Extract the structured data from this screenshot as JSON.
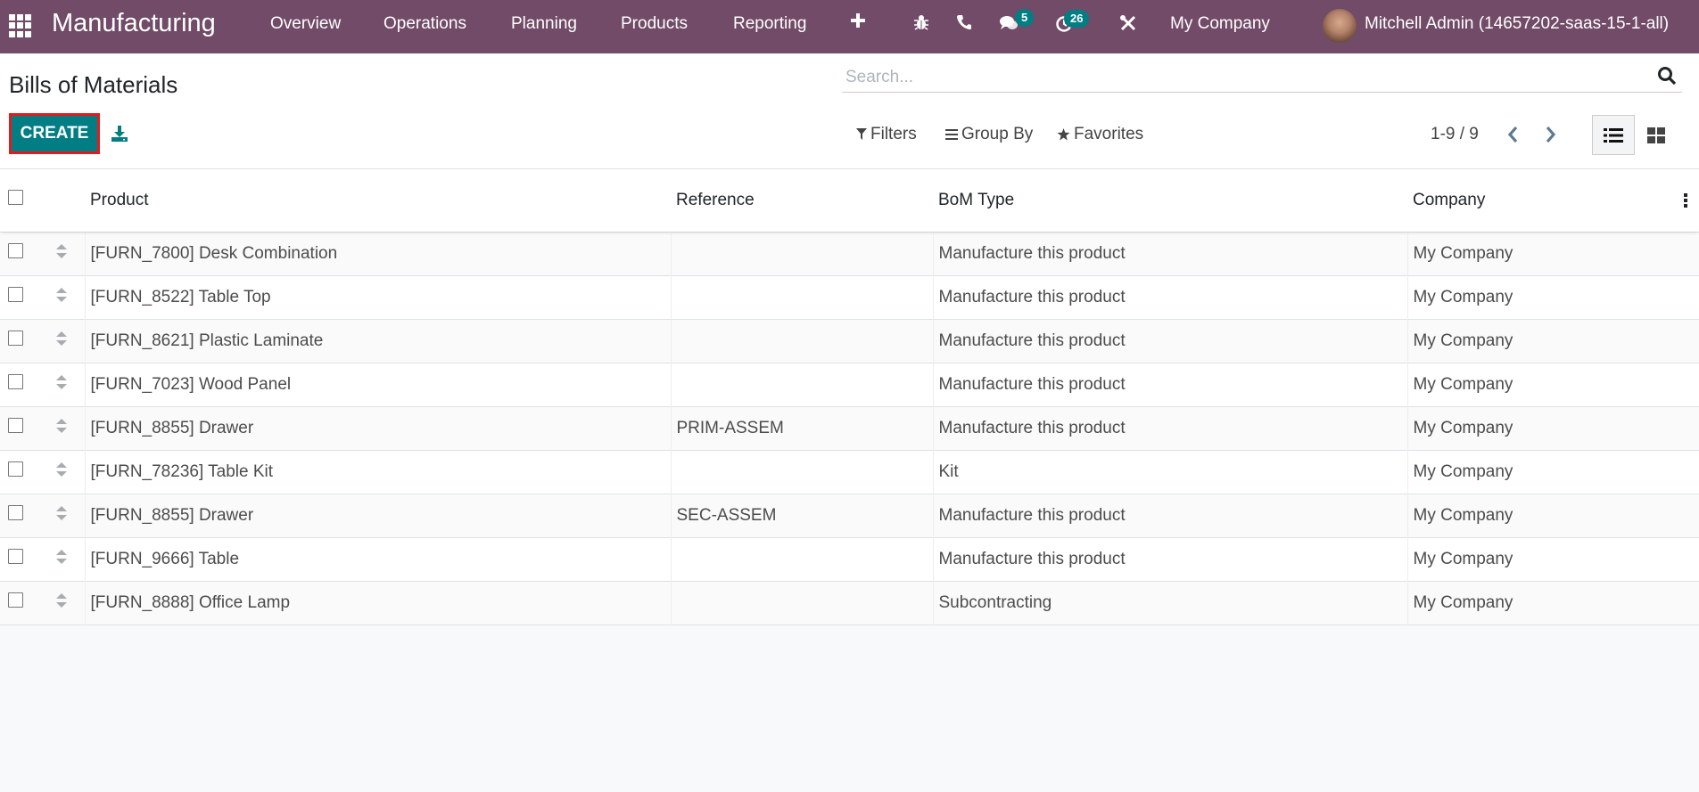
{
  "navbar": {
    "app_name": "Manufacturing",
    "menu": [
      "Overview",
      "Operations",
      "Planning",
      "Products",
      "Reporting"
    ],
    "icons": [
      "plus-icon",
      "bug-icon",
      "phone-icon",
      "chat-icon",
      "activity-clock-icon",
      "tools-icon"
    ],
    "messages_badge": "5",
    "activities_badge": "26",
    "company": "My Company",
    "user": "Mitchell Admin (14657202-saas-15-1-all)"
  },
  "control_panel": {
    "title": "Bills of Materials",
    "create_label": "CREATE",
    "search_placeholder": "Search...",
    "filters_label": "Filters",
    "group_by_label": "Group By",
    "favorites_label": "Favorites",
    "pager": "1-9 / 9"
  },
  "colors": {
    "navbar": "#714b67",
    "primary": "#017e84",
    "highlight_border": "#e31a1c"
  },
  "table": {
    "columns": [
      "Product",
      "Reference",
      "BoM Type",
      "Company"
    ],
    "rows": [
      {
        "product": "[FURN_7800] Desk Combination",
        "reference": "",
        "bom_type": "Manufacture this product",
        "company": "My Company"
      },
      {
        "product": "[FURN_8522] Table Top",
        "reference": "",
        "bom_type": "Manufacture this product",
        "company": "My Company"
      },
      {
        "product": "[FURN_8621] Plastic Laminate",
        "reference": "",
        "bom_type": "Manufacture this product",
        "company": "My Company"
      },
      {
        "product": "[FURN_7023] Wood Panel",
        "reference": "",
        "bom_type": "Manufacture this product",
        "company": "My Company"
      },
      {
        "product": "[FURN_8855] Drawer",
        "reference": "PRIM-ASSEM",
        "bom_type": "Manufacture this product",
        "company": "My Company"
      },
      {
        "product": "[FURN_78236] Table Kit",
        "reference": "",
        "bom_type": "Kit",
        "company": "My Company"
      },
      {
        "product": "[FURN_8855] Drawer",
        "reference": "SEC-ASSEM",
        "bom_type": "Manufacture this product",
        "company": "My Company"
      },
      {
        "product": "[FURN_9666] Table",
        "reference": "",
        "bom_type": "Manufacture this product",
        "company": "My Company"
      },
      {
        "product": "[FURN_8888] Office Lamp",
        "reference": "",
        "bom_type": "Subcontracting",
        "company": "My Company"
      }
    ]
  }
}
